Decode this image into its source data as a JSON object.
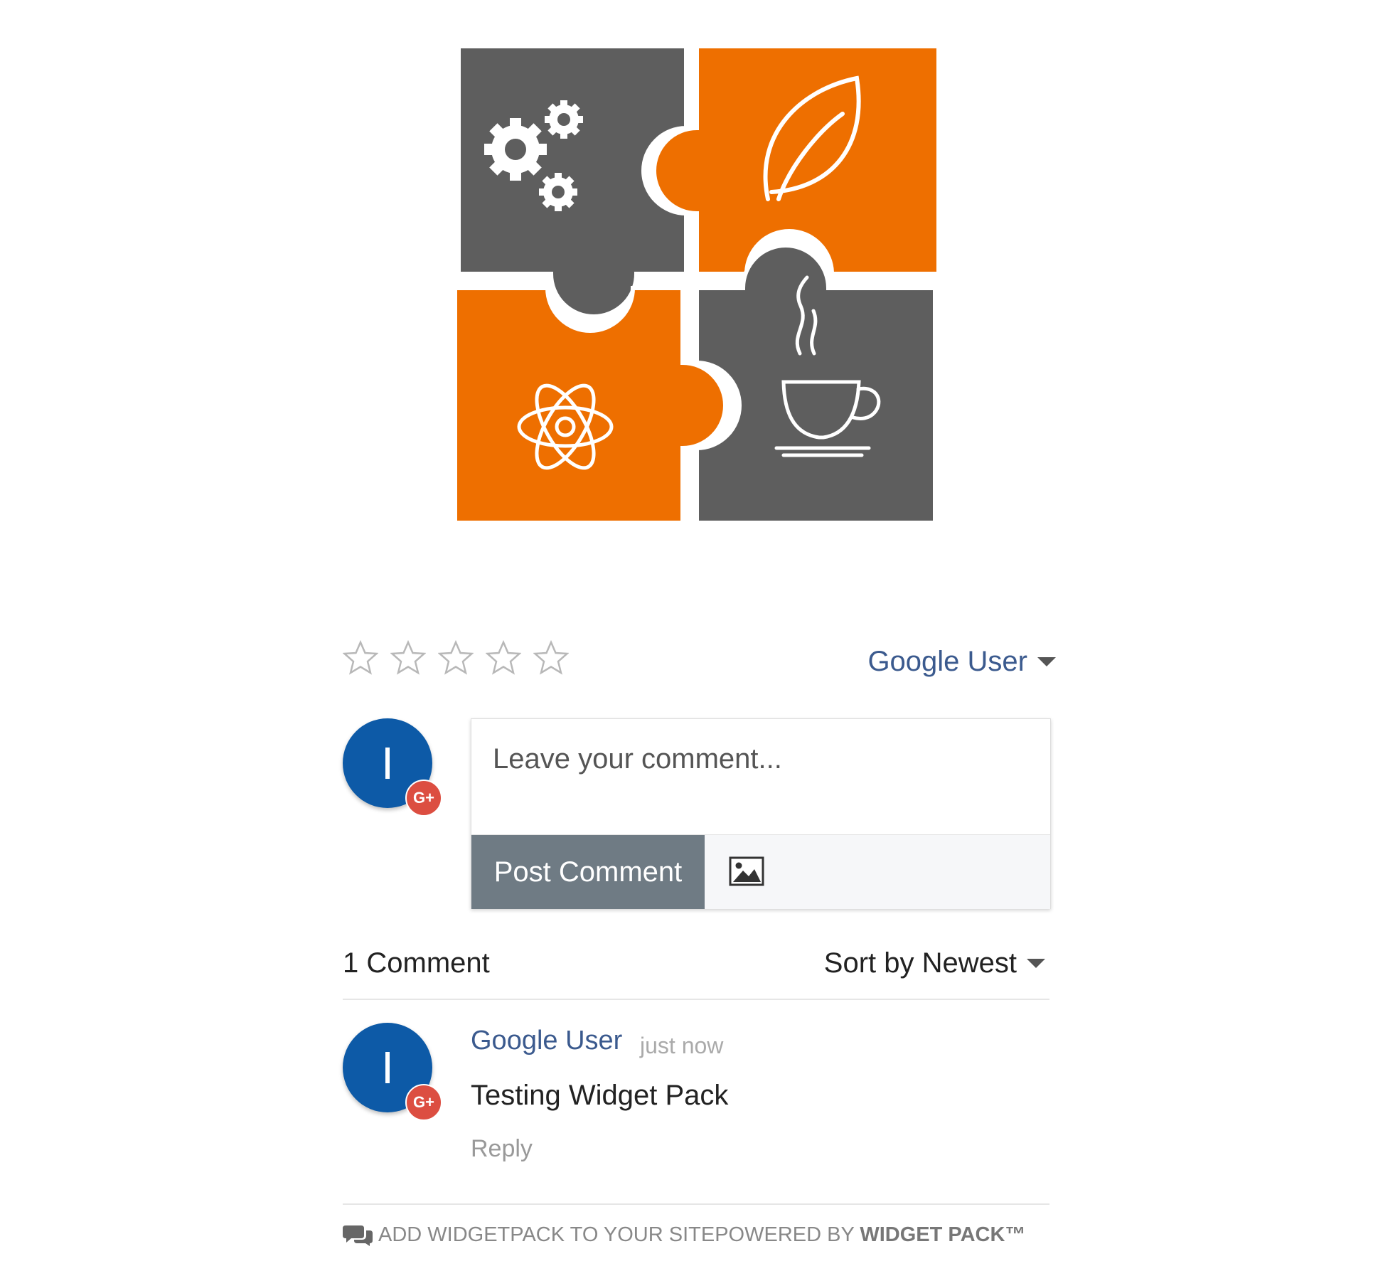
{
  "logo": {
    "colors": {
      "gray": "#5e5e5e",
      "orange": "#ee6f00",
      "line": "#ffffff"
    },
    "icons": [
      "gears-icon",
      "leaf-icon",
      "atom-icon",
      "coffee-cup-icon"
    ]
  },
  "rating": {
    "max": 5,
    "value": 0
  },
  "user_select": {
    "label": "Google User"
  },
  "avatar": {
    "initial": "I",
    "badge": "G+"
  },
  "comment_form": {
    "placeholder": "Leave your comment...",
    "post_label": "Post Comment",
    "image_icon": "image-icon"
  },
  "comments_header": {
    "count_label": "1 Comment",
    "sort_label": "Sort by Newest"
  },
  "comments": [
    {
      "initial": "I",
      "badge": "G+",
      "author": "Google User",
      "time": "just now",
      "text": "Testing Widget Pack",
      "reply_label": "Reply"
    }
  ],
  "footer": {
    "add_label": "ADD WIDGETPACK TO YOUR SITE",
    "powered_prefix": "POWERED BY ",
    "powered_brand": "WIDGET PACK™",
    "icon": "chat-bubbles-icon"
  },
  "colors": {
    "link": "#3b5a8e",
    "avatar_bg": "#0d5aa7",
    "gplus": "#dc4e41",
    "button": "#6f7b84"
  }
}
